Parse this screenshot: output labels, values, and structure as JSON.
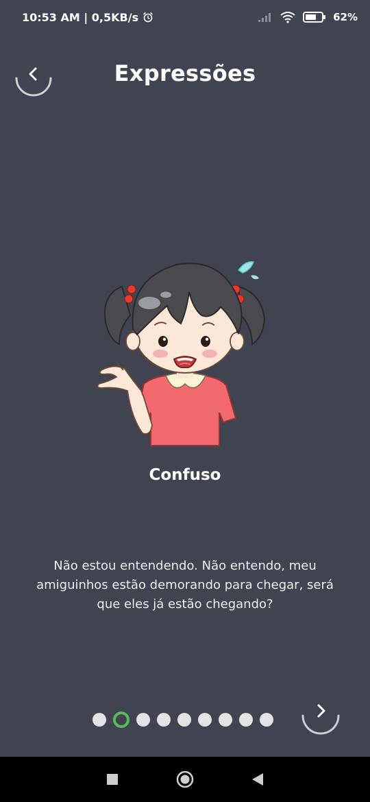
{
  "status_bar": {
    "time_speed": "10:53 AM | 0,5KB/s",
    "battery": "62%",
    "icons": [
      "alarm-icon",
      "signal-icon",
      "wifi-icon",
      "battery-icon"
    ]
  },
  "header": {
    "title": "Expressões",
    "back_icon": "chevron-left-icon"
  },
  "expression": {
    "name": "Confuso",
    "description": "Não estou entendendo. Não entendo, meu amiguinhos estão demorando para chegar, será que eles já estão chegando?"
  },
  "pagination": {
    "total": 9,
    "active_index": 1
  },
  "nav_bar": {
    "icons": [
      "recent-apps-icon",
      "home-icon",
      "back-icon"
    ]
  },
  "colors": {
    "background": "#3f4450",
    "active_dot": "#5cb85c",
    "dot": "#e4e4e4",
    "shirt": "#f06a6e"
  }
}
